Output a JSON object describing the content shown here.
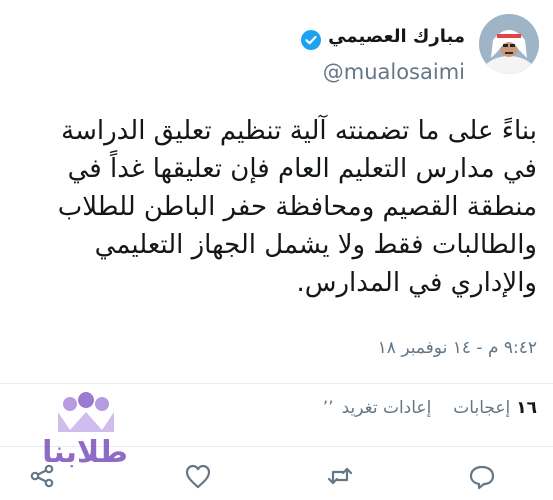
{
  "user": {
    "display_name": "مبارك العصيمي",
    "handle": "@mualosaimi",
    "verified": true
  },
  "tweet": {
    "lines": [
      "بناءً على ما تضمنته آلية تنظيم تعليق الدراسة",
      "في مدارس التعليم العام فإن تعليقها غداً في",
      "منطقة القصيم ومحافظة حفر الباطن للطلاب",
      "والطالبات فقط ولا يشمل الجهاز التعليمي",
      "والإداري في المدارس."
    ],
    "timestamp": "٩:٤٢ م - ١٤ نوفمبر ١٨"
  },
  "stats": {
    "retweets_label": "إعادات تغريد",
    "retweets_count": "",
    "likes_label": "إعجابات",
    "likes_count": "١٦",
    "partial": "٬٬"
  },
  "actions": {
    "reply": "reply-icon",
    "retweet": "retweet-icon",
    "like": "heart-icon",
    "share": "share-icon"
  },
  "watermark": {
    "text": "طلابنا"
  },
  "colors": {
    "text": "#14171a",
    "secondary": "#657786",
    "verified": "#1da1f2",
    "divider": "#e6ecf0",
    "watermark": "#8e6bc6"
  }
}
